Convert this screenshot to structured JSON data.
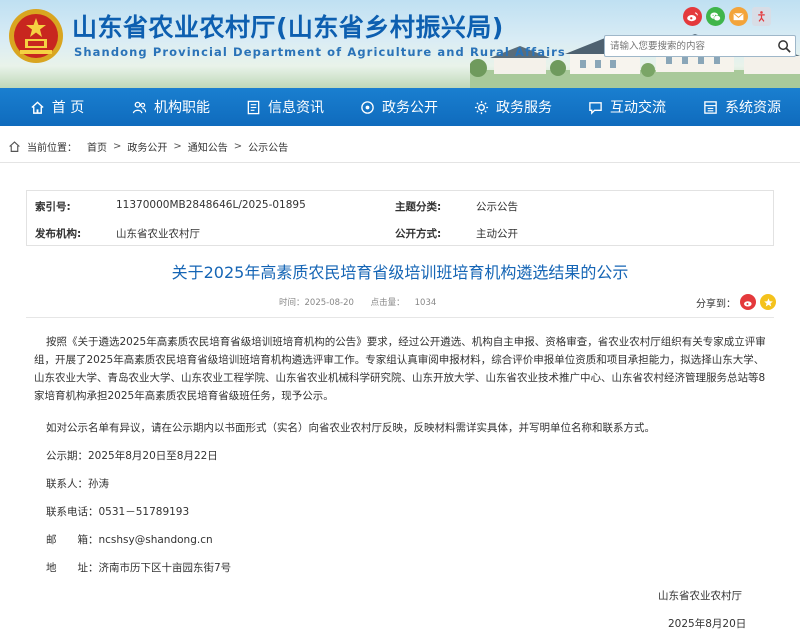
{
  "header": {
    "title": "山东省农业农村厅(山东省乡村振兴局)",
    "subtitle": "Shandong Provincial Department of Agriculture and Rural Affairs",
    "search_placeholder": "请输入您要搜索的内容",
    "social_icons": [
      "weibo-icon",
      "wechat-icon",
      "email-icon",
      "accessibility-icon"
    ]
  },
  "nav": {
    "items": [
      {
        "label": "首 页",
        "icon": "home-icon"
      },
      {
        "label": "机构职能",
        "icon": "org-icon"
      },
      {
        "label": "信息资讯",
        "icon": "news-icon"
      },
      {
        "label": "政务公开",
        "icon": "open-gov-icon"
      },
      {
        "label": "政务服务",
        "icon": "service-icon"
      },
      {
        "label": "互动交流",
        "icon": "chat-icon"
      },
      {
        "label": "系统资源",
        "icon": "system-icon"
      }
    ]
  },
  "breadcrumb": {
    "label": "当前位置：",
    "items": [
      "首页",
      "政务公开",
      "通知公告",
      "公示公告"
    ]
  },
  "meta": {
    "index_key": "索引号:",
    "index_val": "11370000MB2848646L/2025-01895",
    "topic_key": "主题分类:",
    "topic_val": "公示公告",
    "publisher_key": "发布机构:",
    "publisher_val": "山东省农业农村厅",
    "open_key": "公开方式:",
    "open_val": "主动公开"
  },
  "article": {
    "title": "关于2025年高素质农民培育省级培训班培育机构遴选结果的公示",
    "time_label": "时间：",
    "time": "2025-08-20",
    "clicks_label": "点击量：",
    "clicks": "1034",
    "share_label": "分享到：",
    "paragraph1": "按照《关于遴选2025年高素质农民培育省级培训班培育机构的公告》要求，经过公开遴选、机构自主申报、资格审查，省农业农村厅组织有关专家成立评审组，开展了2025年高素质农民培育省级培训班培育机构遴选评审工作。专家组认真审阅申报材料，综合评价申报单位资质和项目承担能力，拟选择山东大学、山东农业大学、青岛农业大学、山东农业工程学院、山东省农业机械科学研究院、山东开放大学、山东省农业技术推广中心、山东省农村经济管理服务总站等8家培育机构承担2025年高素质农民培育省级班任务，现予公示。",
    "paragraph2": "如对公示名单有异议，请在公示期内以书面形式（实名）向省农业农村厅反映，反映材料需详实具体，并写明单位名称和联系方式。",
    "period": "公示期：2025年8月20日至8月22日",
    "contact": "联系人：孙涛",
    "phone": "联系电话：0531－51789193",
    "email_label": "邮　　箱：",
    "email": "ncshsy@shandong.cn",
    "address_label": "地　　址：",
    "address": "济南市历下区十亩园东街7号",
    "signature": "山东省农业农村厅",
    "date": "2025年8月20日"
  }
}
